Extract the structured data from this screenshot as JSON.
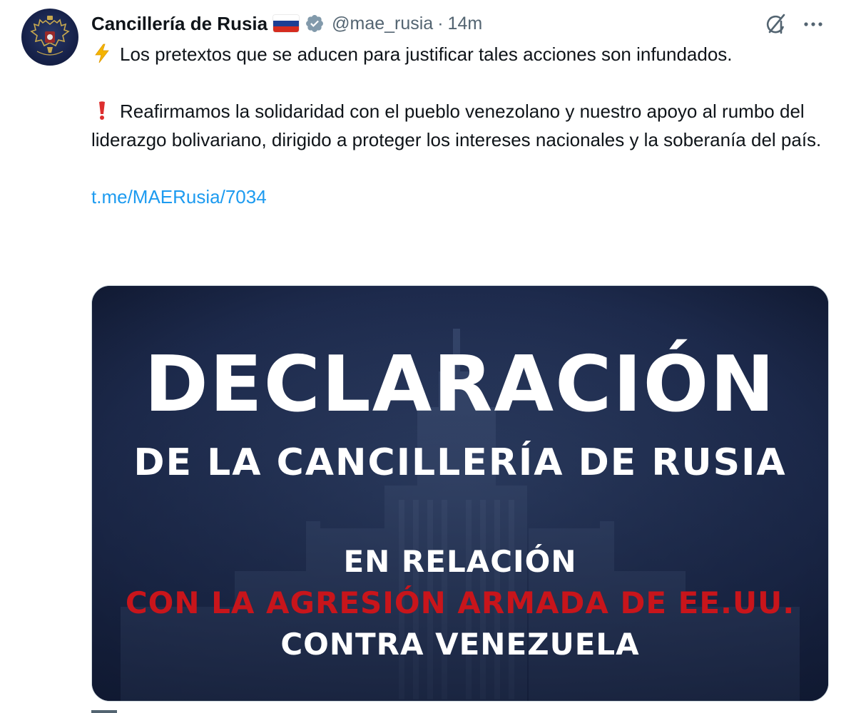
{
  "tweet": {
    "author": {
      "display_name": "Cancillería de Rusia",
      "handle": "@mae_rusia",
      "separator": "·",
      "time": "14m",
      "avatar_icon": "russian-coat-of-arms",
      "flag_icon": "russia-flag",
      "verified_icon": "verified-badge",
      "verified_color": "#829aab"
    },
    "paragraphs": [
      {
        "emoji": "high-voltage-emoji",
        "text": "Los pretextos que se aducen para justificar tales acciones son infundados."
      },
      {
        "emoji": "red-exclamation-emoji",
        "text": "Reafirmamos la solidaridad con el pueblo venezolano y nuestro apoyo al rumbo del liderazgo bolivariano, dirigido a proteger los intereses nacionales y la soberanía del país."
      }
    ],
    "link": "t.me/MAERusia/7034",
    "link_color": "#1d9bf0",
    "actions": {
      "grok_icon": "grok-icon",
      "more_icon": "more-icon"
    },
    "media": {
      "line1": "DECLARACIÓN",
      "line2": "DE LA CANCILLERÍA DE RUSIA",
      "line3": "EN RELACIÓN",
      "line4": "CON LA AGRESIÓN ARMADA DE EE.UU.",
      "line5": "CONTRA VENEZUELA",
      "accent_color": "#c8151b"
    }
  }
}
